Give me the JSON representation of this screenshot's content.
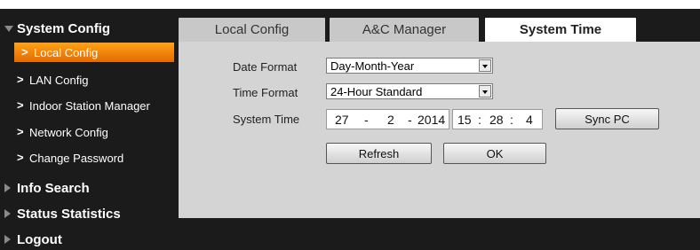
{
  "sidebar": {
    "sections": [
      {
        "label": "System Config",
        "expanded": true
      },
      {
        "label": "Info Search",
        "expanded": false
      },
      {
        "label": "Status Statistics",
        "expanded": false
      },
      {
        "label": "Logout",
        "expanded": false
      }
    ],
    "items": [
      {
        "label": "Local Config",
        "active": true
      },
      {
        "label": "LAN Config"
      },
      {
        "label": "Indoor Station Manager"
      },
      {
        "label": "Network Config"
      },
      {
        "label": "Change Password"
      }
    ],
    "chevron": ">"
  },
  "tabs": [
    {
      "label": "Local Config"
    },
    {
      "label": "A&C Manager"
    },
    {
      "label": "System Time",
      "active": true
    }
  ],
  "form": {
    "date_format": {
      "label": "Date Format",
      "value": "Day-Month-Year"
    },
    "time_format": {
      "label": "Time Format",
      "value": "24-Hour Standard"
    },
    "system_time": {
      "label": "System Time",
      "day": "27",
      "month": "2",
      "year": "2014",
      "hour": "15",
      "minute": "28",
      "second": "4",
      "date_sep": "-",
      "time_sep": ":"
    },
    "sync_pc_label": "Sync PC",
    "refresh_label": "Refresh",
    "ok_label": "OK"
  },
  "colors": {
    "active_accent": "#f28c0f",
    "sidebar_bg": "#1b1b1b",
    "panel_bg": "#d4d4d4"
  }
}
